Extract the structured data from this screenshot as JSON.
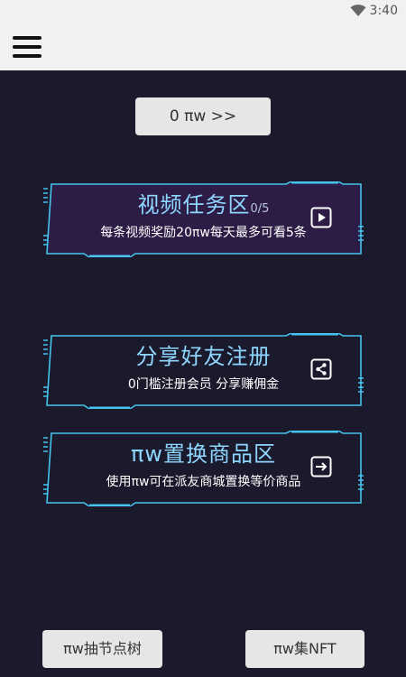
{
  "status_bar": {
    "time": "3:40",
    "wifi_icon": "wifi-icon"
  },
  "app_bar": {
    "menu_icon": "hamburger-menu-icon"
  },
  "balance_button": {
    "label": "0 πw >>"
  },
  "cards": [
    {
      "title": "视频任务区",
      "count": "0/5",
      "subtitle": "每条视频奖励20πw每天最多可看5条",
      "icon": "play-icon"
    },
    {
      "title": "分享好友注册",
      "count": "",
      "subtitle": "0门槛注册会员 分享赚佣金",
      "icon": "share-icon"
    },
    {
      "title": "πw置换商品区",
      "count": "",
      "subtitle": "使用πw可在派友商城置换等价商品",
      "icon": "arrow-right-icon"
    }
  ],
  "bottom_buttons": {
    "left_label": "πw抽节点树",
    "right_label": "πw集NFT"
  },
  "colors": {
    "background": "#1b1a2c",
    "frame_cyan": "#44c4ee",
    "highlight_card": "#2d1c46",
    "title_blue": "#8fd6ff"
  }
}
